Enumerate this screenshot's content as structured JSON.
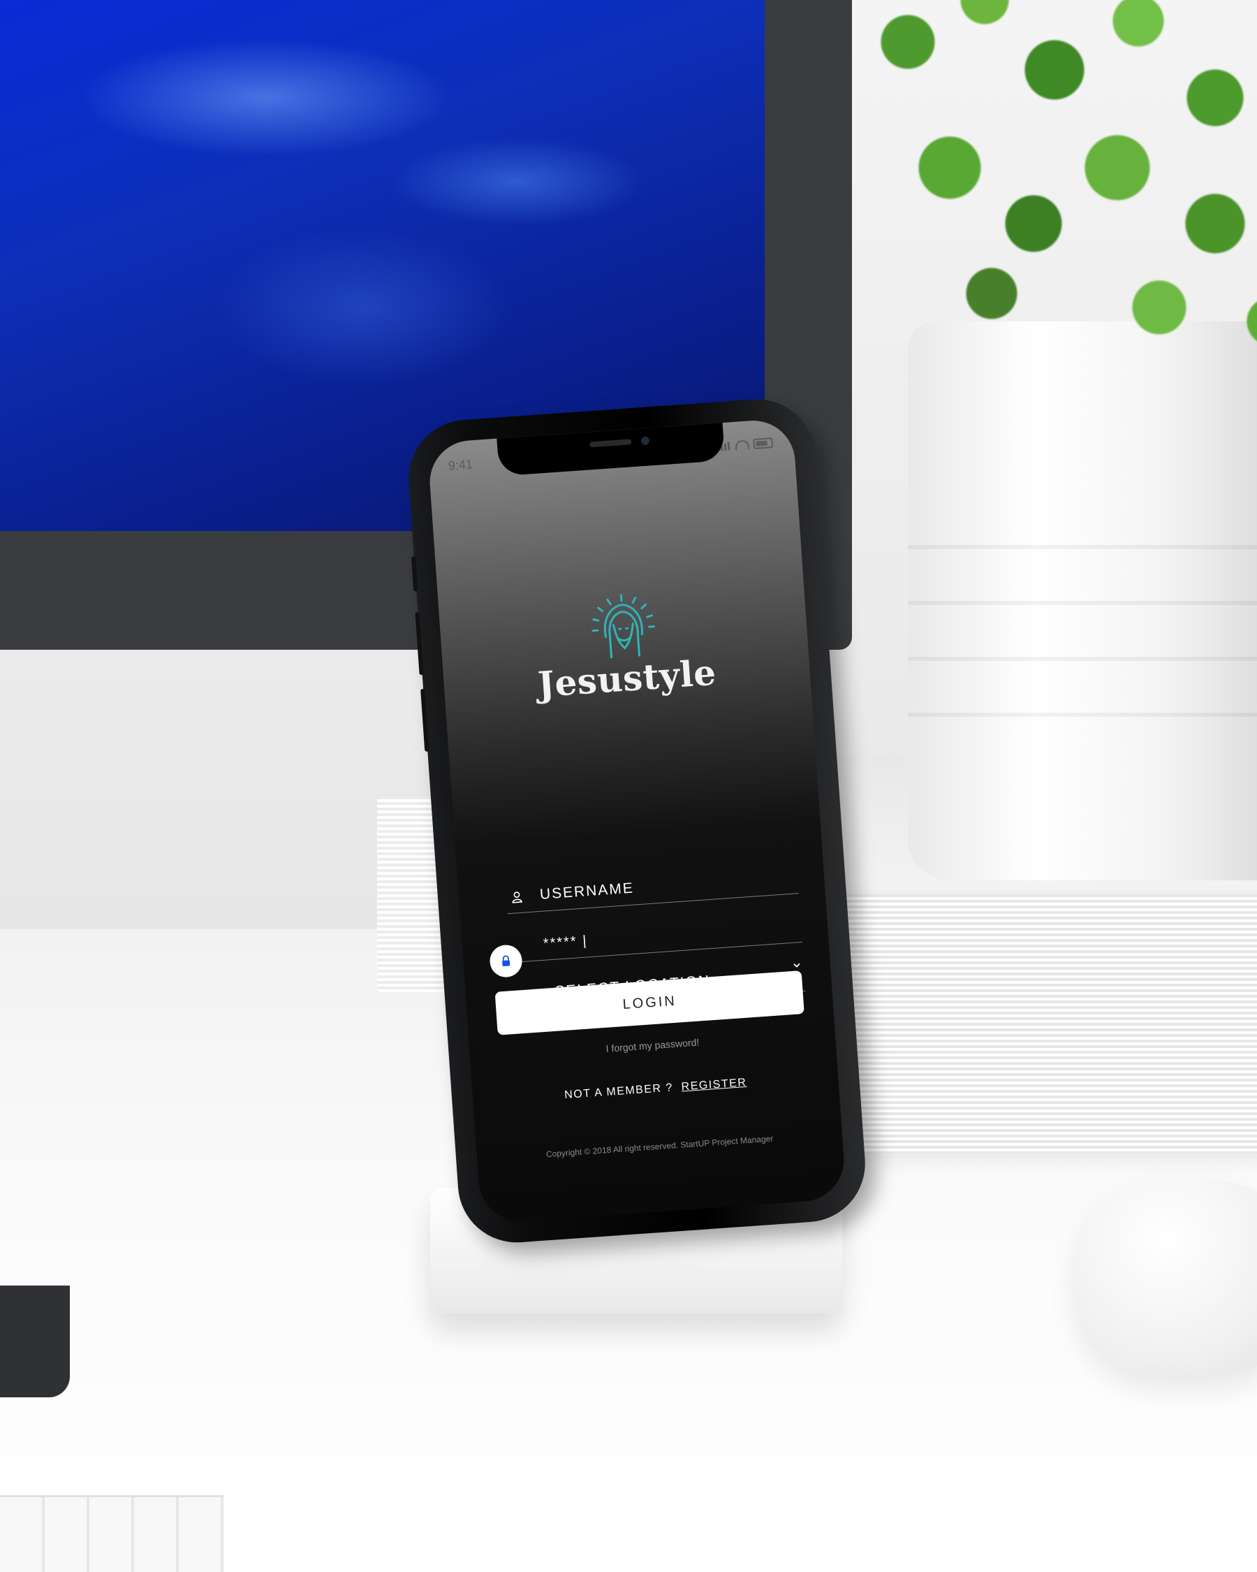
{
  "status_bar": {
    "time": "9:41"
  },
  "app": {
    "brand": "Jesustyle",
    "logo_color": "#2fb3b8"
  },
  "form": {
    "username_label": "USERNAME",
    "password_value": "***** |",
    "location_label": "SELECT LOCATION",
    "login_label": "LOGIN",
    "forgot_label": "I forgot my password!",
    "member_prefix": "NOT A MEMBER ?",
    "register_label": "REGISTER",
    "copyright": "Copyright © 2018 All right reserved. StartUP Project Manager"
  },
  "icons": {
    "user": "user-icon",
    "lock": "lock-icon",
    "calendar": "calendar-icon",
    "chevron": "chevron-down-icon",
    "logo": "jesus-halo-icon"
  }
}
